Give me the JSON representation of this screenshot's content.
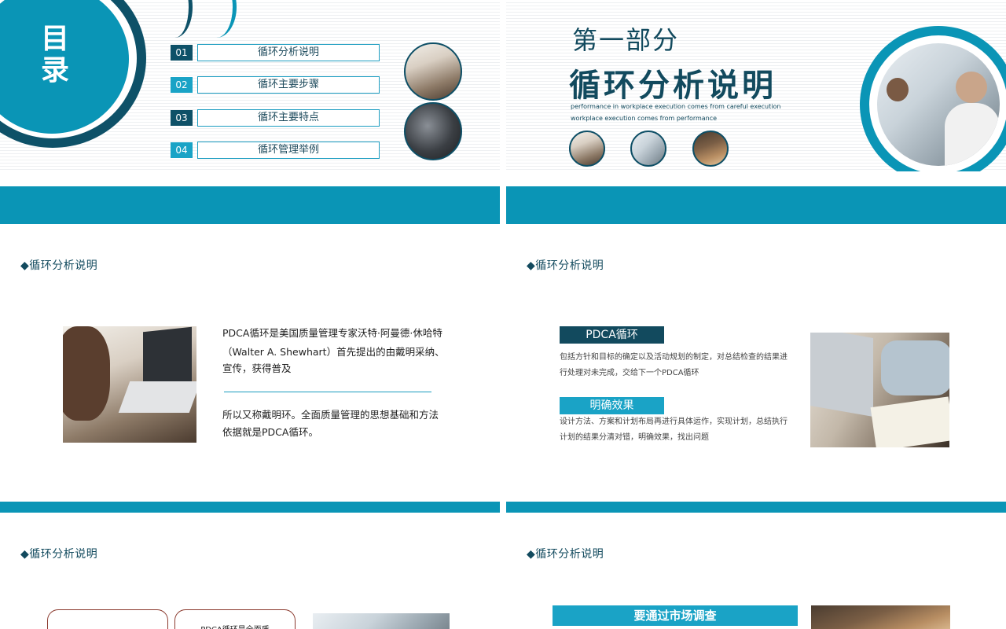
{
  "slide1": {
    "title": "目录",
    "items": [
      {
        "num": "01",
        "label": "循环分析说明"
      },
      {
        "num": "02",
        "label": "循环主要步骤"
      },
      {
        "num": "03",
        "label": "循环主要特点"
      },
      {
        "num": "04",
        "label": "循环管理举例"
      }
    ]
  },
  "slide2": {
    "part": "第一部分",
    "title": "循环分析说明",
    "subtitle_line1": "performance in workplace execution comes from careful execution",
    "subtitle_line2": "workplace execution comes from performance"
  },
  "slide3": {
    "heading": "◆循环分析说明",
    "para1": "PDCA循环是美国质量管理专家沃特·阿曼德·休哈特（Walter A. Shewhart）首先提出的由戴明采纳、宣传，获得普及",
    "para1_line1": "PDCA循环是美国质量管理专家沃特·阿曼德·休哈特",
    "para1_line2": "（Walter A. Shewhart）首先提出的由戴明采纳、",
    "para1_line3": "宣传，获得普及",
    "para2_line1": "所以又称戴明环。全面质量管理的思想基础和方法",
    "para2_line2": "依据就是PDCA循环。"
  },
  "slide4": {
    "heading": "◆循环分析说明",
    "box1_title": "PDCA循环",
    "box1_line1": "包括方针和目标的确定以及活动规划的制定，对总结检查的结果进",
    "box1_line2": "行处理对未完成，交给下一个PDCA循环",
    "box2_title": "明确效果",
    "box2_line1": "设计方法、方案和计划布局再进行具体运作，实现计划，总结执行",
    "box2_line2": "计划的结果分清对错，明确效果，找出问题"
  },
  "slide5": {
    "heading": "◆循环分析说明",
    "card2_text": "PDCA循环是全面质"
  },
  "slide6": {
    "heading": "◆循环分析说明",
    "banner": "要通过市场调查"
  },
  "colors": {
    "primary": "#0a95b6",
    "dark": "#124a5e",
    "accent_brown": "#8b3a2e"
  }
}
